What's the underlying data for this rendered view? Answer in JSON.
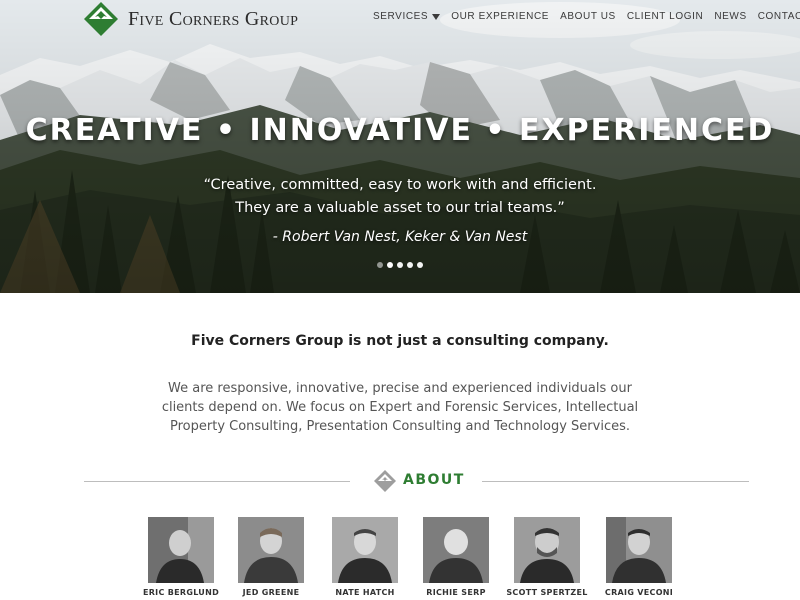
{
  "brand": {
    "name": "Five Corners Group",
    "accent_color": "#2e7d32",
    "logo_icon": "mountain-diamond-icon"
  },
  "nav": {
    "items": [
      {
        "label": "SERVICES",
        "has_dropdown": true
      },
      {
        "label": "OUR EXPERIENCE"
      },
      {
        "label": "ABOUT US"
      },
      {
        "label": "CLIENT LOGIN"
      },
      {
        "label": "NEWS"
      },
      {
        "label": "CONTACT"
      }
    ]
  },
  "hero": {
    "headline": "CREATIVE • INNOVATIVE • EXPERIENCED",
    "quote_line1": "“Creative, committed, easy to work with and efficient.",
    "quote_line2": "They are a valuable asset to our trial teams.”",
    "attribution": "- Robert Van Nest, Keker & Van Nest",
    "slide_count": 5,
    "active_slide": 1
  },
  "intro": {
    "title": "Five Corners Group is not just a consulting company.",
    "body": "We are responsive, innovative, precise and experienced individuals our clients depend on. We focus on Expert and Forensic Services, Intellectual Property Consulting, Presentation Consulting and Technology Services."
  },
  "about": {
    "label": "ABOUT",
    "team": [
      {
        "name": "ERIC BERGLUND"
      },
      {
        "name": "JED GREENE"
      },
      {
        "name": "NATE HATCH"
      },
      {
        "name": "RICHIE SERP"
      },
      {
        "name": "SCOTT SPERTZEL"
      },
      {
        "name": "CRAIG VECONI"
      }
    ]
  }
}
